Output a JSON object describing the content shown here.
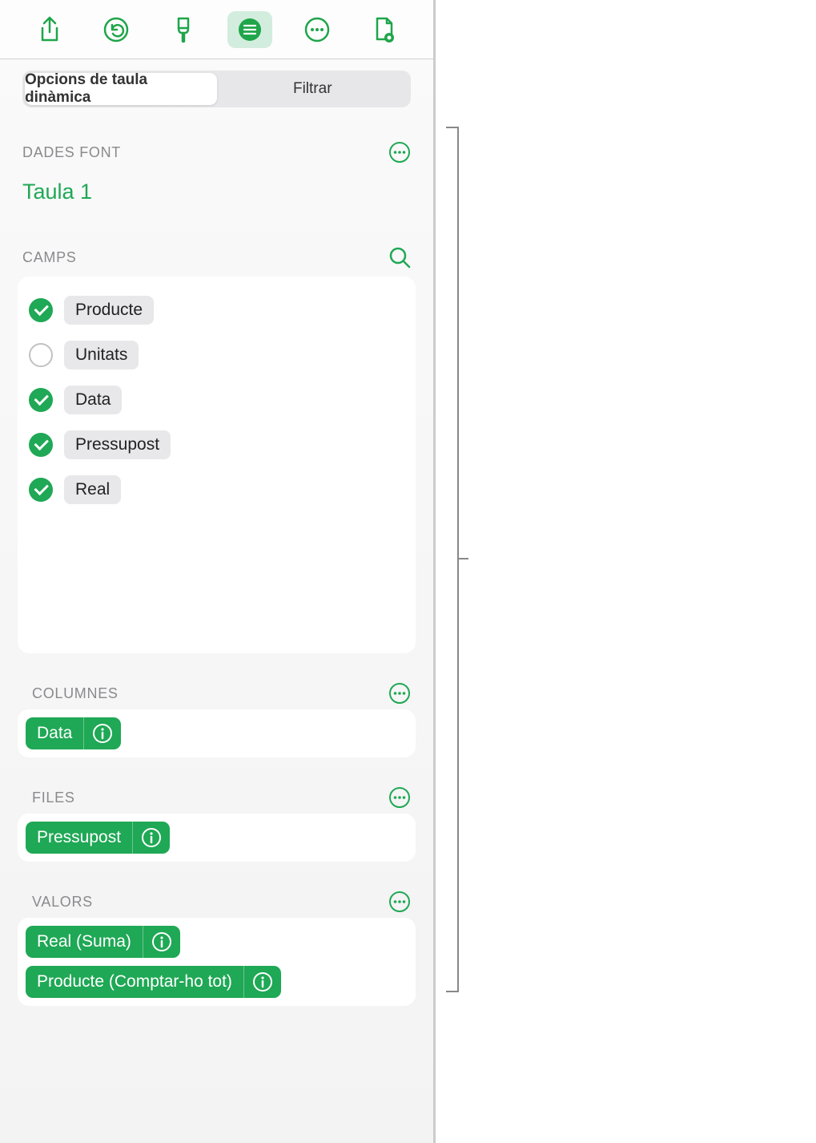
{
  "tabs": {
    "options": "Opcions de taula dinàmica",
    "filter": "Filtrar"
  },
  "source": {
    "label": "DADES FONT",
    "name": "Taula 1"
  },
  "fields": {
    "label": "CAMPS",
    "items": [
      {
        "name": "Producte",
        "checked": true
      },
      {
        "name": "Unitats",
        "checked": false
      },
      {
        "name": "Data",
        "checked": true
      },
      {
        "name": "Pressupost",
        "checked": true
      },
      {
        "name": "Real",
        "checked": true
      }
    ]
  },
  "columns": {
    "label": "COLUMNES",
    "items": [
      "Data"
    ]
  },
  "rows": {
    "label": "FILES",
    "items": [
      "Pressupost"
    ]
  },
  "values": {
    "label": "VALORS",
    "items": [
      "Real (Suma)",
      "Producte (Comptar-ho tot)"
    ]
  }
}
